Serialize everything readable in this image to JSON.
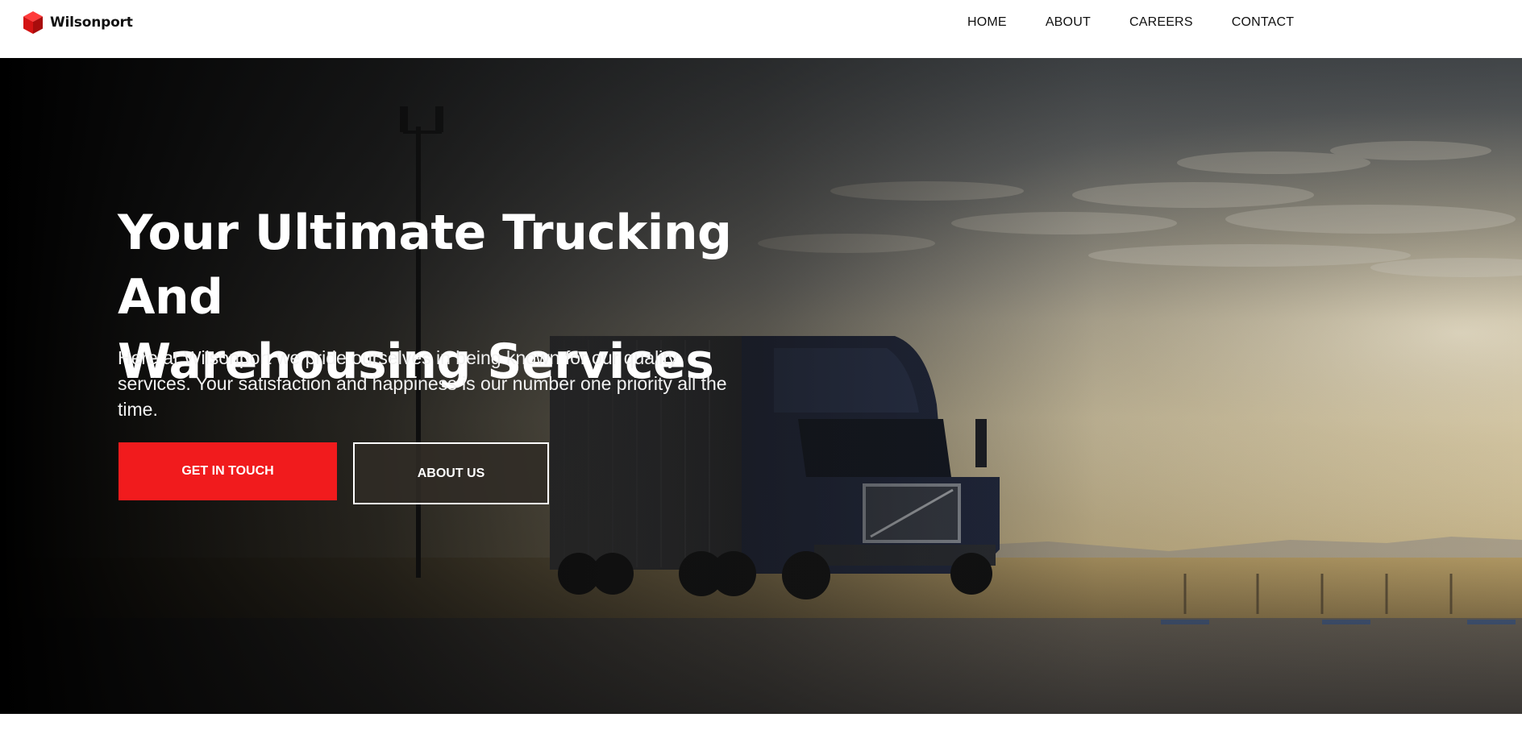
{
  "brand": {
    "name": "Wilsonport",
    "logo_icon": "cube-icon",
    "accent_color": "#f11b1d"
  },
  "nav": {
    "items": [
      {
        "label": "HOME"
      },
      {
        "label": "ABOUT"
      },
      {
        "label": "CAREERS"
      },
      {
        "label": "CONTACT"
      }
    ]
  },
  "hero": {
    "title_line_1": "Your Ultimate Trucking And",
    "title_line_2": "Warehousing Services",
    "description": "Here at Wilsonport we pride ourselves in being known for our quality services. Your satisfaction and happiness is our number one priority all the time.",
    "primary_button": "GET IN TOUCH",
    "secondary_button": "ABOUT US",
    "background": "truck-on-road-at-sunset"
  }
}
